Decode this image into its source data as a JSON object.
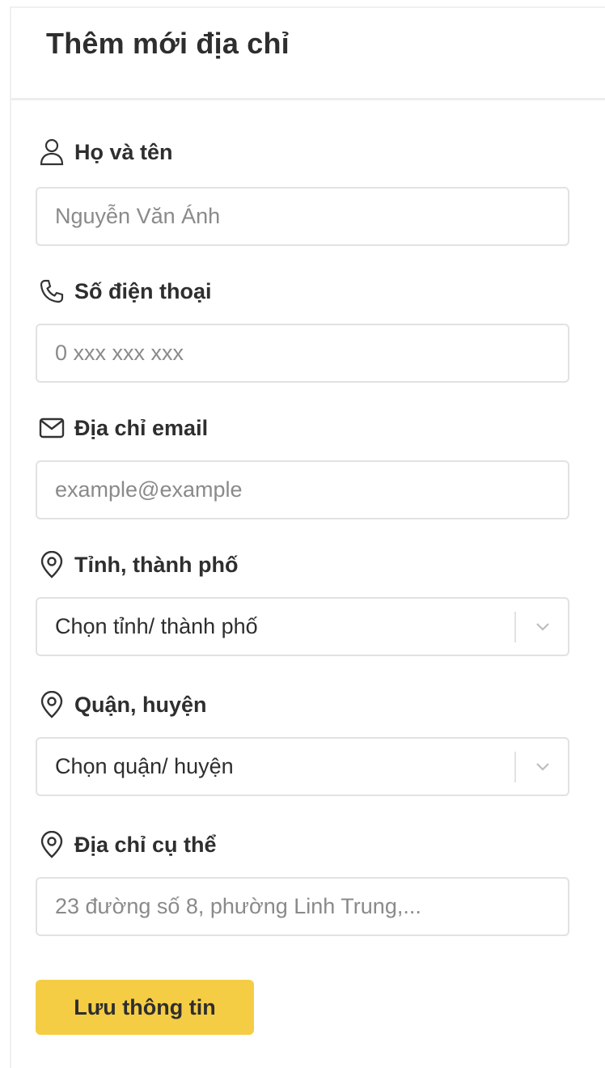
{
  "header": {
    "title": "Thêm mới địa chỉ"
  },
  "form": {
    "full_name": {
      "label": "Họ và tên",
      "placeholder": "Nguyễn Văn Ánh",
      "icon": "user-icon"
    },
    "phone": {
      "label": "Số điện thoại",
      "placeholder": "0 xxx xxx xxx",
      "icon": "phone-icon"
    },
    "email": {
      "label": "Địa chỉ email",
      "placeholder": "example@example",
      "icon": "mail-icon"
    },
    "province": {
      "label": "Tỉnh, thành phố",
      "selected": "Chọn tỉnh/ thành phố",
      "icon": "location-pin-icon"
    },
    "district": {
      "label": "Quận, huyện",
      "selected": "Chọn quận/ huyện",
      "icon": "location-pin-icon"
    },
    "address": {
      "label": "Địa chỉ cụ thể",
      "placeholder": "23 đường số 8, phường Linh Trung,...",
      "icon": "location-pin-icon"
    }
  },
  "actions": {
    "save_label": "Lưu thông tin"
  },
  "colors": {
    "accent": "#f4cd45",
    "border": "#e2e2e2",
    "placeholder": "#8a8a8a",
    "text": "#2e2e2e"
  }
}
